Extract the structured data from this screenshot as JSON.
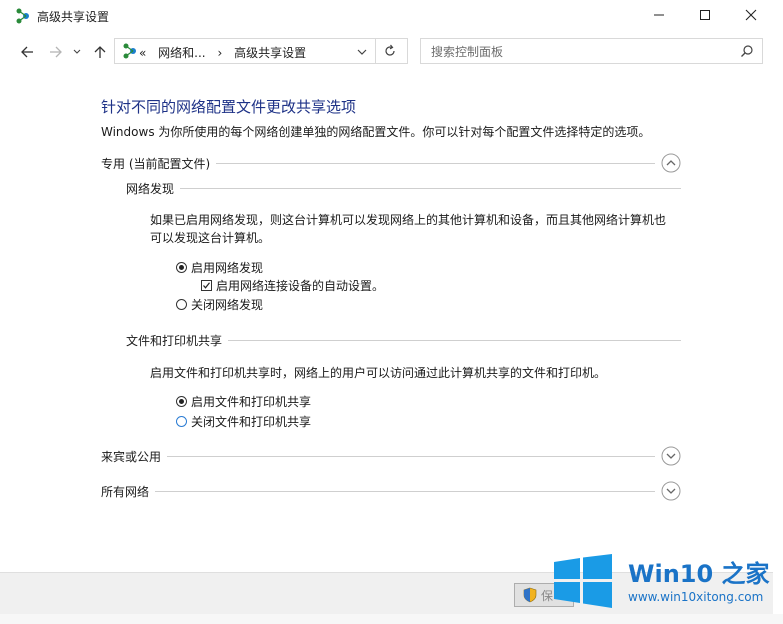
{
  "window": {
    "title": "高级共享设置",
    "minimize_icon": "minimize-icon",
    "maximize_icon": "maximize-icon",
    "close_icon": "close-icon"
  },
  "nav": {
    "back_icon": "arrow-left-icon",
    "forward_icon": "arrow-right-icon",
    "recent_icon": "chevron-down-icon",
    "up_icon": "arrow-up-icon",
    "address": {
      "overflow": "«",
      "crumbs": [
        "网络和...",
        "高级共享设置"
      ],
      "separator": "›"
    },
    "search": {
      "placeholder": "搜索控制面板"
    }
  },
  "main": {
    "heading": "针对不同的网络配置文件更改共享选项",
    "description": "Windows 为你所使用的每个网络创建单独的网络配置文件。你可以针对每个配置文件选择特定的选项。",
    "profiles": [
      {
        "label": "专用 (当前配置文件)",
        "expanded": true
      },
      {
        "label": "来宾或公用",
        "expanded": false
      },
      {
        "label": "所有网络",
        "expanded": false
      }
    ],
    "network_discovery": {
      "title": "网络发现",
      "text": "如果已启用网络发现，则这台计算机可以发现网络上的其他计算机和设备，而且其他网络计算机也可以发现这台计算机。",
      "options": {
        "on": "启用网络发现",
        "auto": "启用网络连接设备的自动设置。",
        "off": "关闭网络发现"
      }
    },
    "file_sharing": {
      "title": "文件和打印机共享",
      "text": "启用文件和打印机共享时，网络上的用户可以访问通过此计算机共享的文件和打印机。",
      "options": {
        "on": "启用文件和打印机共享",
        "off": "关闭文件和打印机共享"
      }
    }
  },
  "footer": {
    "save_label": "保"
  },
  "watermark": {
    "brand": "Win10 之家",
    "url": "www.win10xitong.com"
  },
  "colors": {
    "heading": "#1e3287",
    "radio_blue": "#2b7cd3",
    "watermark": "#1a73c7"
  }
}
